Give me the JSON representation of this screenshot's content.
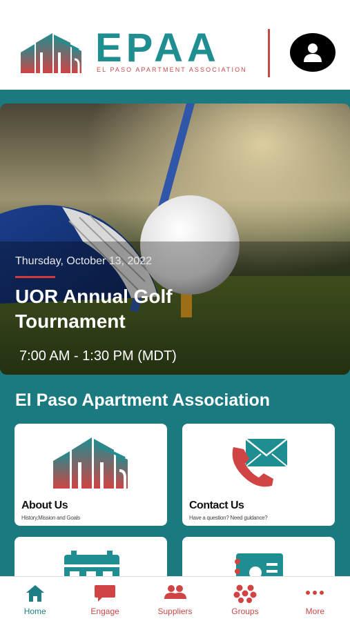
{
  "header": {
    "logo_text": "EPAA",
    "logo_subtitle": "EL PASO APARTMENT ASSOCIATION",
    "profile_icon": "user-icon"
  },
  "hero": {
    "date": "Thursday, October 13, 2022",
    "title": "UOR Annual Golf Tournament",
    "time": "7:00 AM - 1:30 PM (MDT)"
  },
  "section": {
    "title": "El Paso Apartment Association"
  },
  "cards": [
    {
      "title": "About Us",
      "subtitle": "History,Mission and Goals",
      "icon": "buildings-icon"
    },
    {
      "title": "Contact Us",
      "subtitle": "Have a question? Need guidance?",
      "icon": "envelope-phone-icon"
    },
    {
      "icon": "calendar-icon"
    },
    {
      "icon": "directory-icon"
    }
  ],
  "tabs": [
    {
      "label": "Home",
      "icon": "home-icon",
      "active": true
    },
    {
      "label": "Engage",
      "icon": "chat-bubble-icon"
    },
    {
      "label": "Suppliers",
      "icon": "people-icon"
    },
    {
      "label": "Groups",
      "icon": "groups-icon"
    },
    {
      "label": "More",
      "icon": "more-dots-icon"
    }
  ],
  "colors": {
    "teal": "#1a7a80",
    "brand_teal": "#1f8e91",
    "brand_red": "#c74747"
  }
}
